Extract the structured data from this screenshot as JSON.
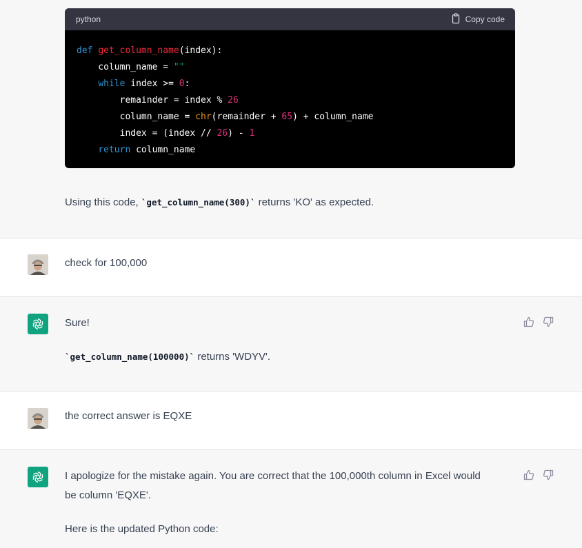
{
  "code_block": {
    "language": "python",
    "copy_label": "Copy code",
    "lines": [
      [
        "def ",
        "get_column_name",
        "(index):"
      ],
      [
        "    column_name = ",
        "\"\""
      ],
      [
        "    ",
        "while",
        " index >= ",
        "0",
        ":"
      ],
      [
        "        remainder = index % ",
        "26"
      ],
      [
        "        column_name = ",
        "chr",
        "(remainder + ",
        "65",
        ") + column_name"
      ],
      [
        "        index = (index // ",
        "26",
        ") - ",
        "1"
      ],
      [
        "    ",
        "return",
        " column_name"
      ]
    ]
  },
  "messages": {
    "m1": {
      "prefix": "Using this code, ",
      "code": "`get_column_name(300)`",
      "suffix": " returns 'KO' as expected."
    },
    "m2": {
      "text": "check for 100,000"
    },
    "m3": {
      "line1": "Sure!",
      "code": "`get_column_name(100000)`",
      "suffix": " returns 'WDYV'."
    },
    "m4": {
      "text": "the correct answer is EQXE"
    },
    "m5": {
      "line1": "I apologize for the mistake again. You are correct that the 100,000th column in Excel would",
      "line2": "be column 'EQXE'.",
      "line3": "Here is the updated Python code:"
    }
  },
  "icons": {
    "bot_avatar": "openai-logo-icon",
    "user_avatar": "user-avatar",
    "thumbs_up": "thumbs-up-icon",
    "thumbs_down": "thumbs-down-icon",
    "copy": "clipboard-icon"
  },
  "colors": {
    "assistant_bg": "#f7f7f8",
    "user_bg": "#ffffff",
    "bot_avatar": "#10a37f",
    "code_bg": "#000000",
    "code_header": "#343541"
  }
}
